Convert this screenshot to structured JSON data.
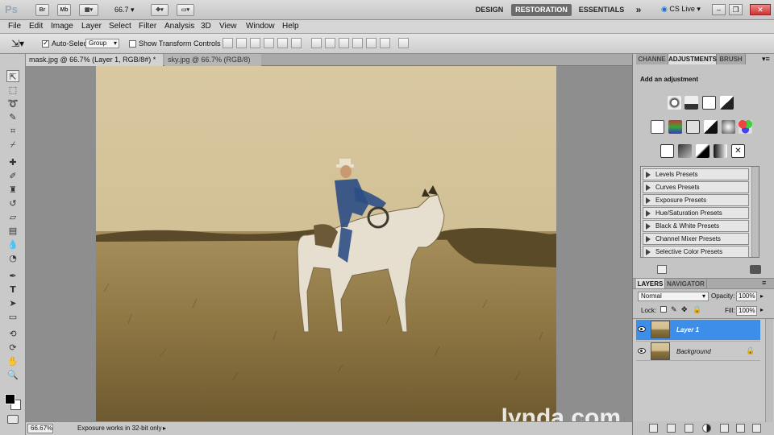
{
  "app": {
    "logo": "Ps",
    "launch_buttons": [
      "Br",
      "Mb"
    ],
    "zoom": "66.7",
    "workspaces": [
      "DESIGN",
      "RESTORATION",
      "ESSENTIALS"
    ],
    "active_workspace": "RESTORATION",
    "more": "»",
    "cs_live": "CS Live"
  },
  "menu": [
    "File",
    "Edit",
    "Image",
    "Layer",
    "Select",
    "Filter",
    "Analysis",
    "3D",
    "View",
    "Window",
    "Help"
  ],
  "options": {
    "auto_select_label": "Auto-Select:",
    "auto_select_value": "Group",
    "show_transform_label": "Show Transform Controls"
  },
  "tabs": [
    {
      "label": "mask.jpg @ 66.7% (Layer 1, RGB/8#) *",
      "active": true
    },
    {
      "label": "sky.jpg @ 66.7% (RGB/8)",
      "active": false
    }
  ],
  "status": {
    "zoom": "66.67%",
    "info": "Exposure works in 32-bit only"
  },
  "panels": {
    "top_tabs": [
      "CHANNE",
      "ADJUSTMENTS",
      "BRUSH"
    ],
    "active_top_tab": "ADJUSTMENTS",
    "adjust_title": "Add an adjustment",
    "presets": [
      "Levels Presets",
      "Curves Presets",
      "Exposure Presets",
      "Hue/Saturation Presets",
      "Black & White Presets",
      "Channel Mixer Presets",
      "Selective Color Presets"
    ],
    "layer_tabs": [
      "LAYERS",
      "NAVIGATOR"
    ],
    "blend_mode": "Normal",
    "opacity_label": "Opacity:",
    "opacity_value": "100%",
    "lock_label": "Lock:",
    "fill_label": "Fill:",
    "fill_value": "100%",
    "layers": [
      {
        "name": "Layer 1",
        "selected": true
      },
      {
        "name": "Background",
        "selected": false,
        "locked": true
      }
    ]
  },
  "watermark": "lynda.com",
  "colors": {
    "selection": "#3d8ee8",
    "active_workspace_bg": "#6c6c6c",
    "photo_sepia": "#c9b68a"
  }
}
